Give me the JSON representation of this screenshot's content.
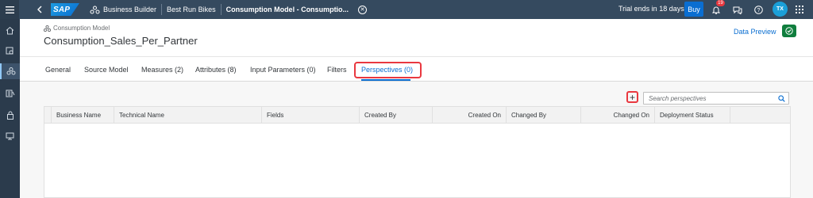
{
  "shell": {
    "logo_text": "SAP",
    "app_name": "Business Builder",
    "space_name": "Best Run Bikes",
    "page_title": "Consumption Model - Consumptio...",
    "trial_text": "Trial ends in 18 days",
    "buy_label": "Buy",
    "notification_count": "19",
    "user_initials": "TX",
    "accent_color": "#0a6ed1"
  },
  "header": {
    "object_type": "Consumption Model",
    "object_name": "Consumption_Sales_Per_Partner",
    "data_preview_label": "Data Preview"
  },
  "tabs": [
    {
      "label": "General"
    },
    {
      "label": "Source Model"
    },
    {
      "label": "Measures (2)"
    },
    {
      "label": "Attributes (8)"
    },
    {
      "label": "Input Parameters (0)"
    },
    {
      "label": "Filters"
    },
    {
      "label": "Perspectives (0)",
      "selected": true
    }
  ],
  "toolbar": {
    "search_placeholder": "Search perspectives"
  },
  "table": {
    "columns": [
      {
        "label": "Business Name"
      },
      {
        "label": "Technical Name"
      },
      {
        "label": "Fields"
      },
      {
        "label": "Created By"
      },
      {
        "label": "Created On"
      },
      {
        "label": "Changed By"
      },
      {
        "label": "Changed On"
      },
      {
        "label": "Deployment Status"
      }
    ],
    "rows": []
  },
  "sidenav": {
    "icons": [
      "home-icon",
      "data-builder-icon",
      "business-builder-icon",
      "data-access-icon",
      "security-icon",
      "monitor-icon"
    ]
  }
}
